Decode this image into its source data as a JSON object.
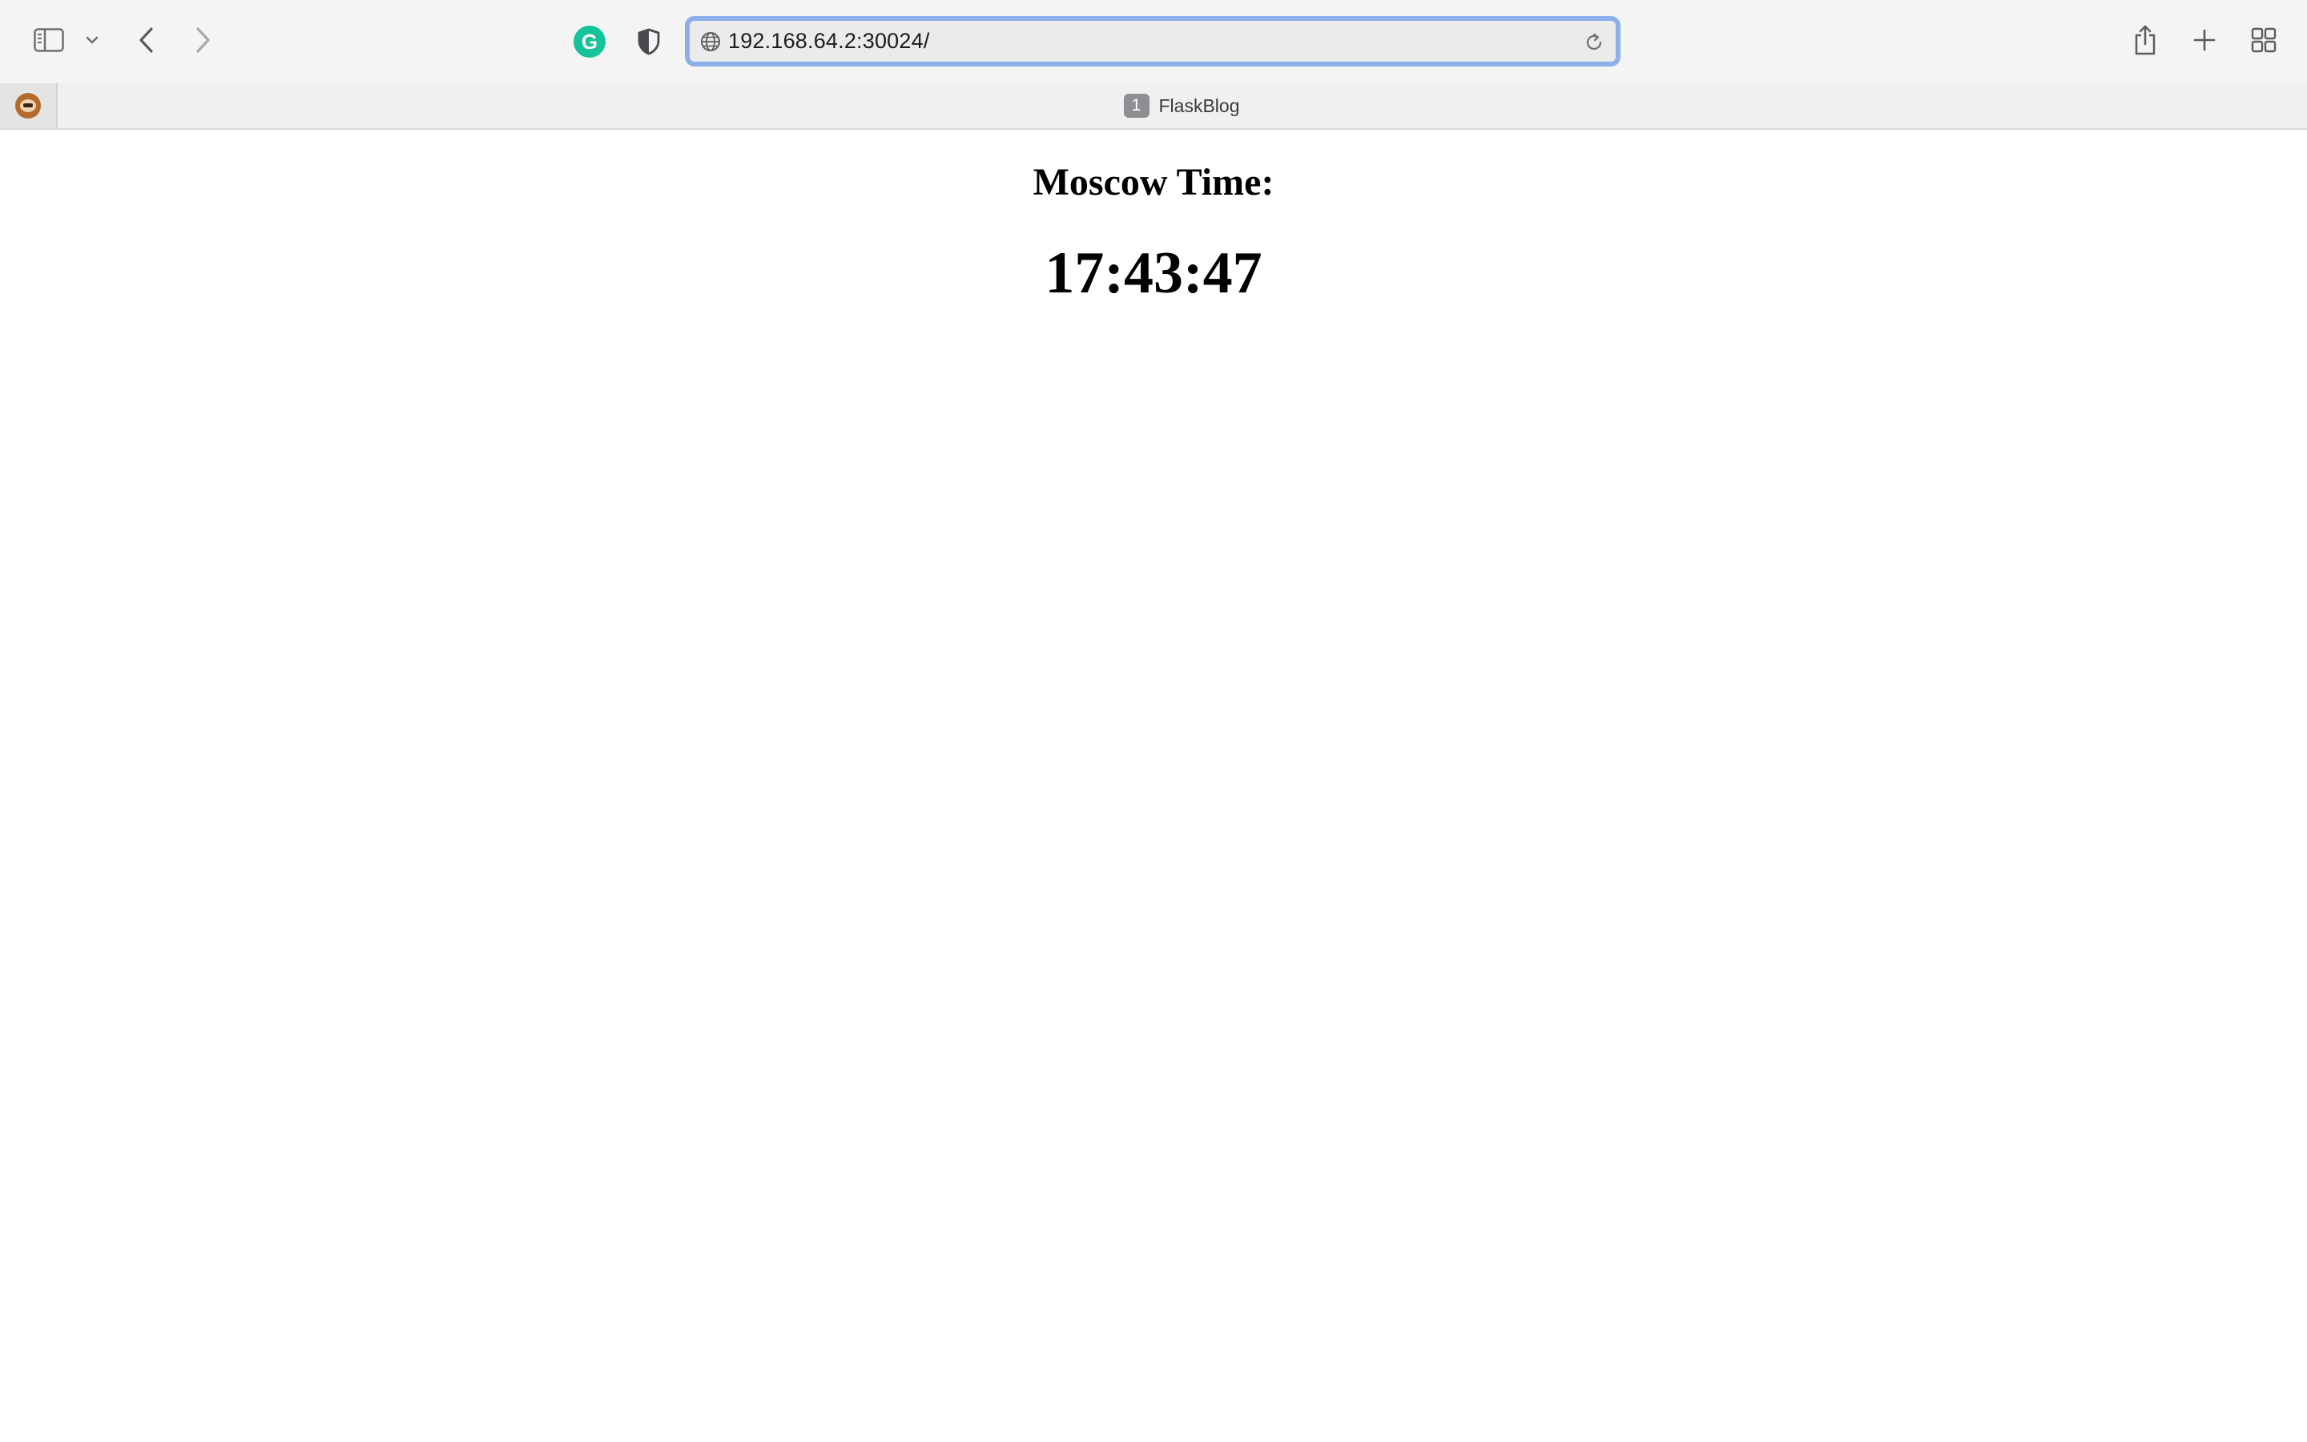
{
  "browser": {
    "address_bar": {
      "url": "192.168.64.2:30024/"
    },
    "tabs": [
      {
        "badge": "1",
        "title": "FlaskBlog",
        "active": true
      }
    ],
    "toolbar": {
      "left_icons": [
        "sidebar-icon",
        "chevron-down-icon",
        "back-arrow-icon",
        "forward-arrow-icon"
      ],
      "extension_icons": [
        "grammarly-icon",
        "privacy-shield-icon"
      ],
      "right_icons": [
        "share-icon",
        "new-tab-icon",
        "tab-overview-icon"
      ]
    },
    "colors": {
      "address_bar_focus": "#8caee9",
      "grammarly": "#15c39a",
      "toolbar_bg": "#f4f4f4"
    }
  },
  "page": {
    "heading": "Moscow Time:",
    "time": "17:43:47"
  }
}
